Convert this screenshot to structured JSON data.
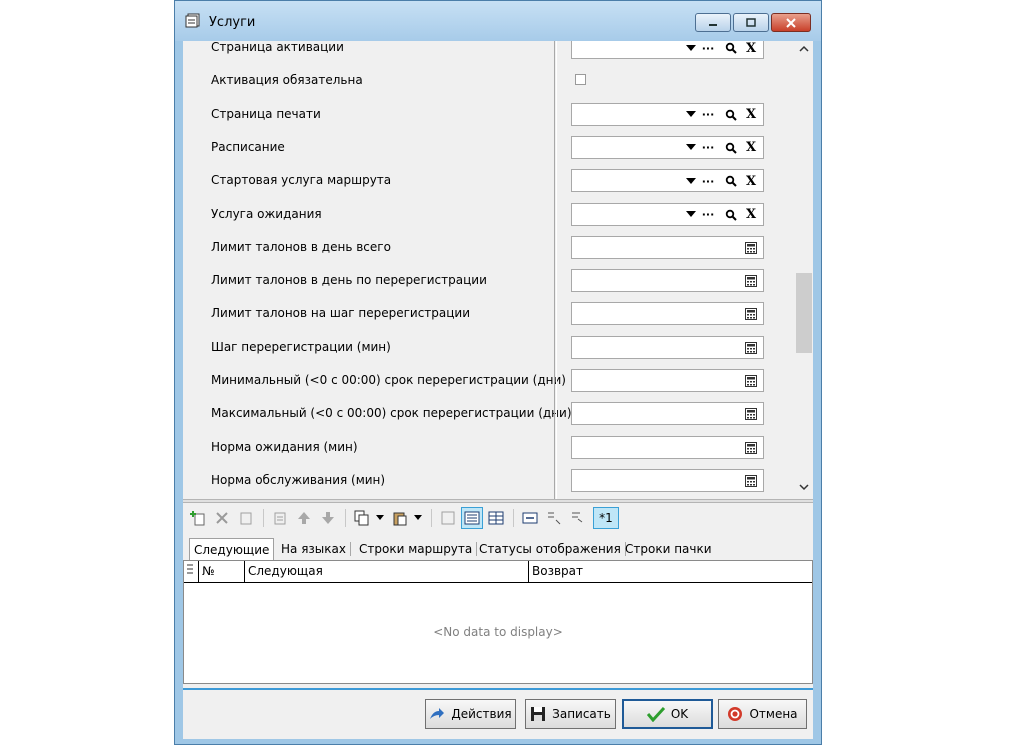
{
  "window": {
    "title": "Услуги"
  },
  "form": {
    "fields": [
      {
        "label": "Страница активации",
        "kind": "lookup"
      },
      {
        "label": "Активация обязательна",
        "kind": "check",
        "checked": false
      },
      {
        "label": "Страница печати",
        "kind": "lookup"
      },
      {
        "label": "Расписание",
        "kind": "lookup"
      },
      {
        "label": "Стартовая услуга маршрута",
        "kind": "lookup"
      },
      {
        "label": "Услуга ожидания",
        "kind": "lookup"
      },
      {
        "label": "Лимит талонов в день всего",
        "kind": "number"
      },
      {
        "label": "Лимит талонов в день по перерегистрации",
        "kind": "number"
      },
      {
        "label": "Лимит талонов на шаг перерегистрации",
        "kind": "number"
      },
      {
        "label": "Шаг перерегистрации (мин)",
        "kind": "number"
      },
      {
        "label": "Минимальный (<0 с 00:00) срок перерегистрации (дни)",
        "kind": "number"
      },
      {
        "label": "Максимальный (<0 с 00:00) срок перерегистрации (дни)",
        "kind": "number"
      },
      {
        "label": "Норма ожидания (мин)",
        "kind": "number"
      },
      {
        "label": "Норма обслуживания (мин)",
        "kind": "number"
      }
    ],
    "lookup_icons": {
      "dots": "···",
      "clear": "X"
    }
  },
  "toolbar": {
    "record_label": "*1"
  },
  "tabs": [
    {
      "label": "Следующие",
      "selected": true
    },
    {
      "label": "На языках",
      "selected": false
    },
    {
      "label": "Строки маршрута",
      "selected": false
    },
    {
      "label": "Статусы отображения",
      "selected": false
    },
    {
      "label": "Строки пачки",
      "selected": false
    }
  ],
  "grid": {
    "columns": [
      "№",
      "Следующая",
      "Возврат"
    ],
    "empty_text": "<No data to display>"
  },
  "buttons": {
    "actions": "Действия",
    "save": "Записать",
    "ok": "OK",
    "cancel": "Отмена"
  },
  "colors": {
    "accent": "#3d9ad7",
    "window_frame": "#9fc7e6",
    "ok_check": "#2e9e2e",
    "cancel_icon": "#d23a2a"
  }
}
